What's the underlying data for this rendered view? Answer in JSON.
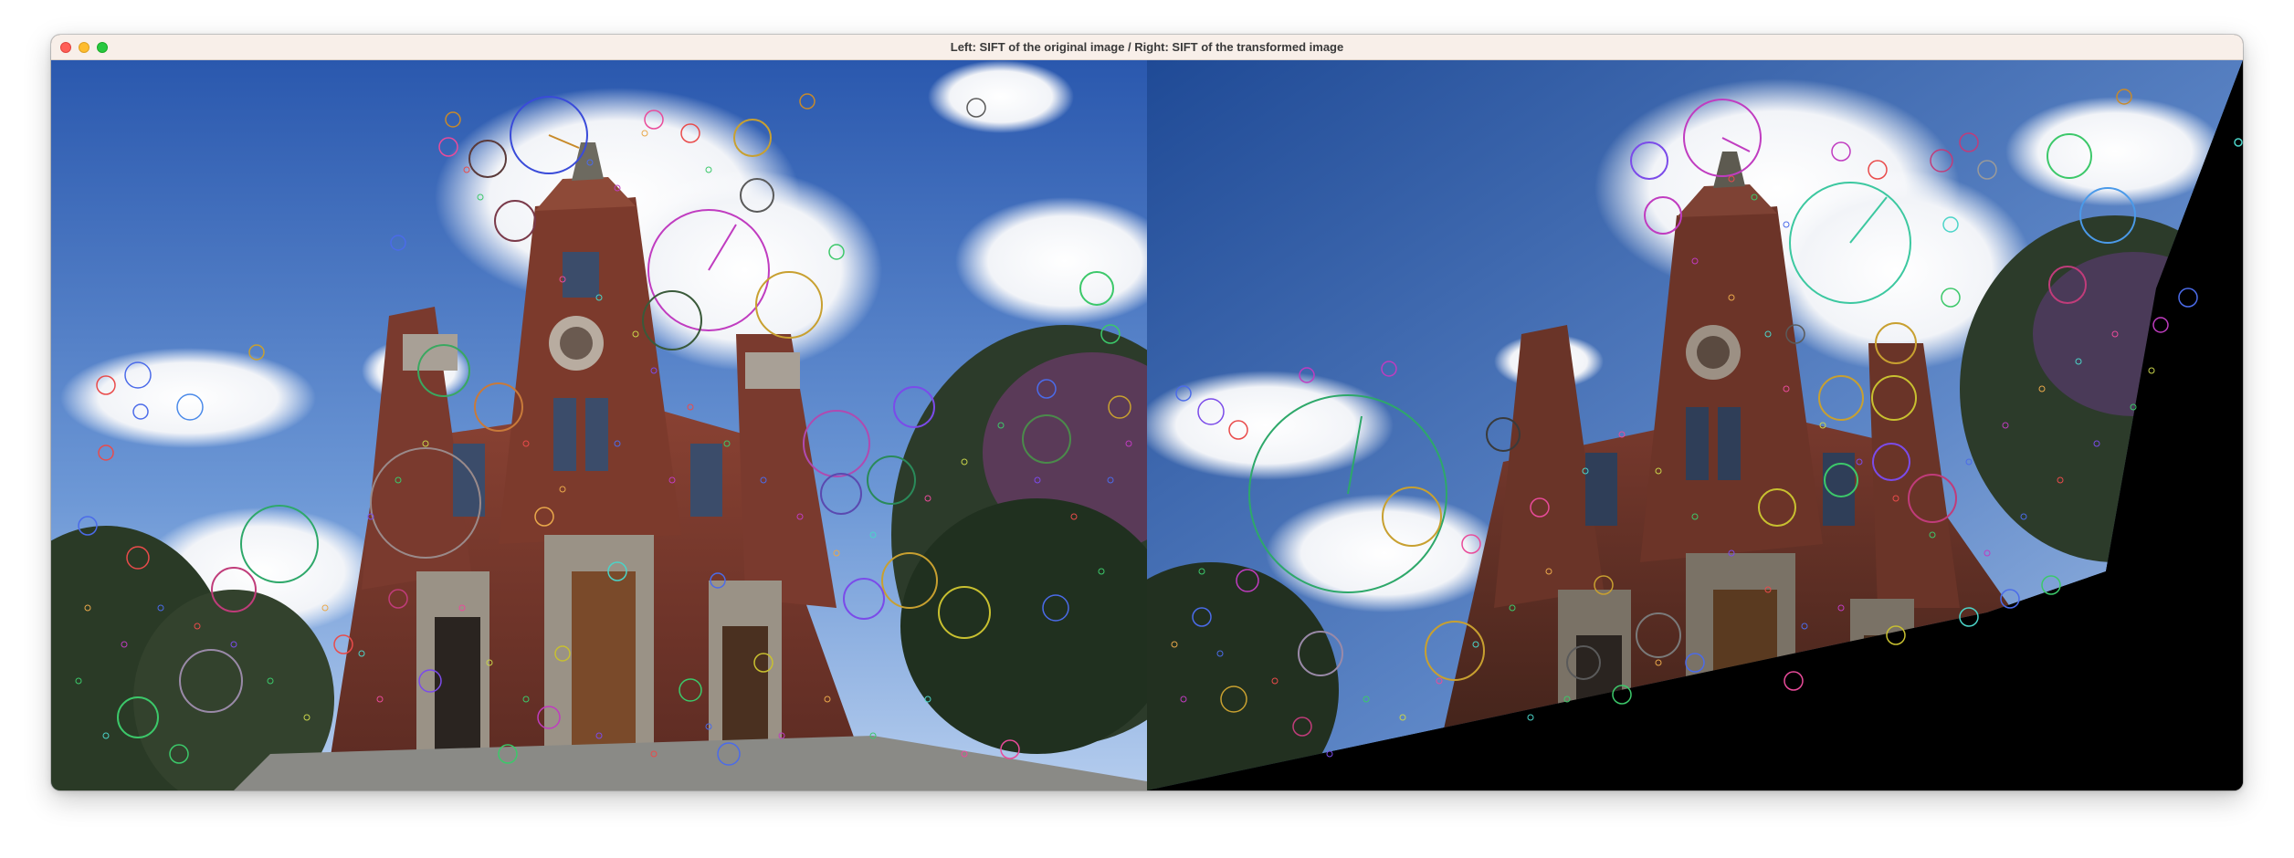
{
  "window": {
    "title": "Left: SIFT of the original image / Right: SIFT of the transformed image"
  },
  "panels": [
    {
      "name": "original",
      "keypoint_colors": [
        "#e94b4b",
        "#4b6be9",
        "#3cc86a",
        "#d44bd4",
        "#e9a84b",
        "#7b4be9",
        "#4bd4c8",
        "#c8d44b",
        "#6a3c3c",
        "#e94b9a"
      ]
    },
    {
      "name": "transformed",
      "keypoint_colors": [
        "#e94b4b",
        "#4b6be9",
        "#3cc86a",
        "#d44bd4",
        "#e9a84b",
        "#7b4be9",
        "#4bd4c8",
        "#c8d44b",
        "#e94b9a",
        "#ffffff"
      ]
    }
  ],
  "colors": {
    "titlebar": "#f8efe9",
    "sky_top": "#2f5fb4",
    "sky_bottom": "#a9c6ea",
    "brick": "#7a3a2e"
  }
}
